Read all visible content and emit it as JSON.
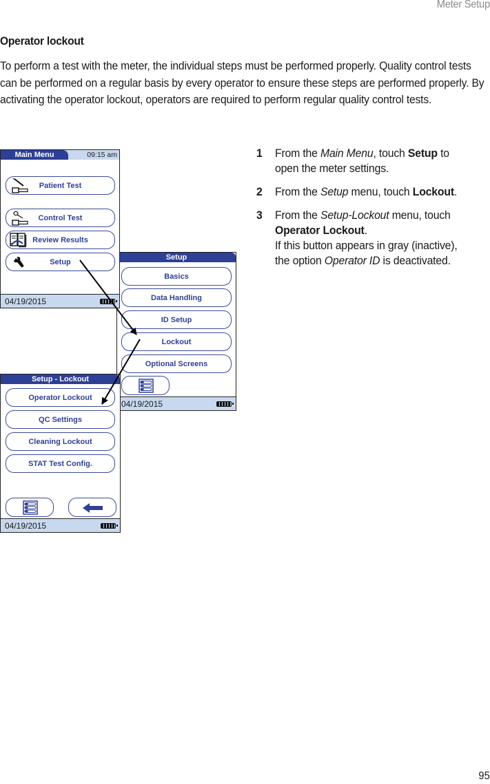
{
  "running_head": "Meter Setup",
  "section_title": "Operator lockout",
  "intro_text": "To perform a test with the meter, the individual steps must be performed properly. Quality control tests can be performed on a regular basis by every operator to ensure these steps are performed properly. By activating the operator lockout, operators are required to perform regular quality control tests.",
  "screens": {
    "main_menu": {
      "title": "Main Menu",
      "time": "09:15 am",
      "buttons": [
        {
          "label": "Patient Test",
          "icon": "syringe-strip-icon"
        },
        {
          "label": "Control Test",
          "icon": "control-strip-icon"
        },
        {
          "label": "Review Results",
          "icon": "book-icon"
        },
        {
          "label": "Setup",
          "icon": "wrench-icon"
        }
      ],
      "date": "04/19/2015",
      "battery": "full"
    },
    "setup": {
      "title": "Setup",
      "buttons": [
        "Basics",
        "Data Handling",
        "ID Setup",
        "Lockout",
        "Optional Screens"
      ],
      "menu_icon": "menu-list-icon",
      "date": "04/19/2015",
      "battery": "full"
    },
    "setup_lockout": {
      "title": "Setup - Lockout",
      "buttons": [
        "Operator Lockout",
        "QC Settings",
        "Cleaning Lockout",
        "STAT Test Config."
      ],
      "menu_icon": "menu-list-icon",
      "back_icon": "back-arrow-icon",
      "date": "04/19/2015",
      "battery": "full"
    }
  },
  "steps": [
    {
      "num": "1",
      "pre": "From the ",
      "em": "Main Menu",
      "mid": ", touch ",
      "bold": "Setup",
      "post": " to open the meter settings."
    },
    {
      "num": "2",
      "pre": "From the ",
      "em": "Setup",
      "mid": " menu, touch ",
      "bold": "Lockout",
      "post": "."
    },
    {
      "num": "3",
      "pre": "From the ",
      "em": "Setup-Lockout",
      "mid": " menu, touch ",
      "bold": "Operator Lockout",
      "post": ".",
      "note_pre": "If this button appears in gray (inactive), the option ",
      "note_em": "Operator ID",
      "note_post": " is deactivated."
    }
  ],
  "page_number": "95"
}
